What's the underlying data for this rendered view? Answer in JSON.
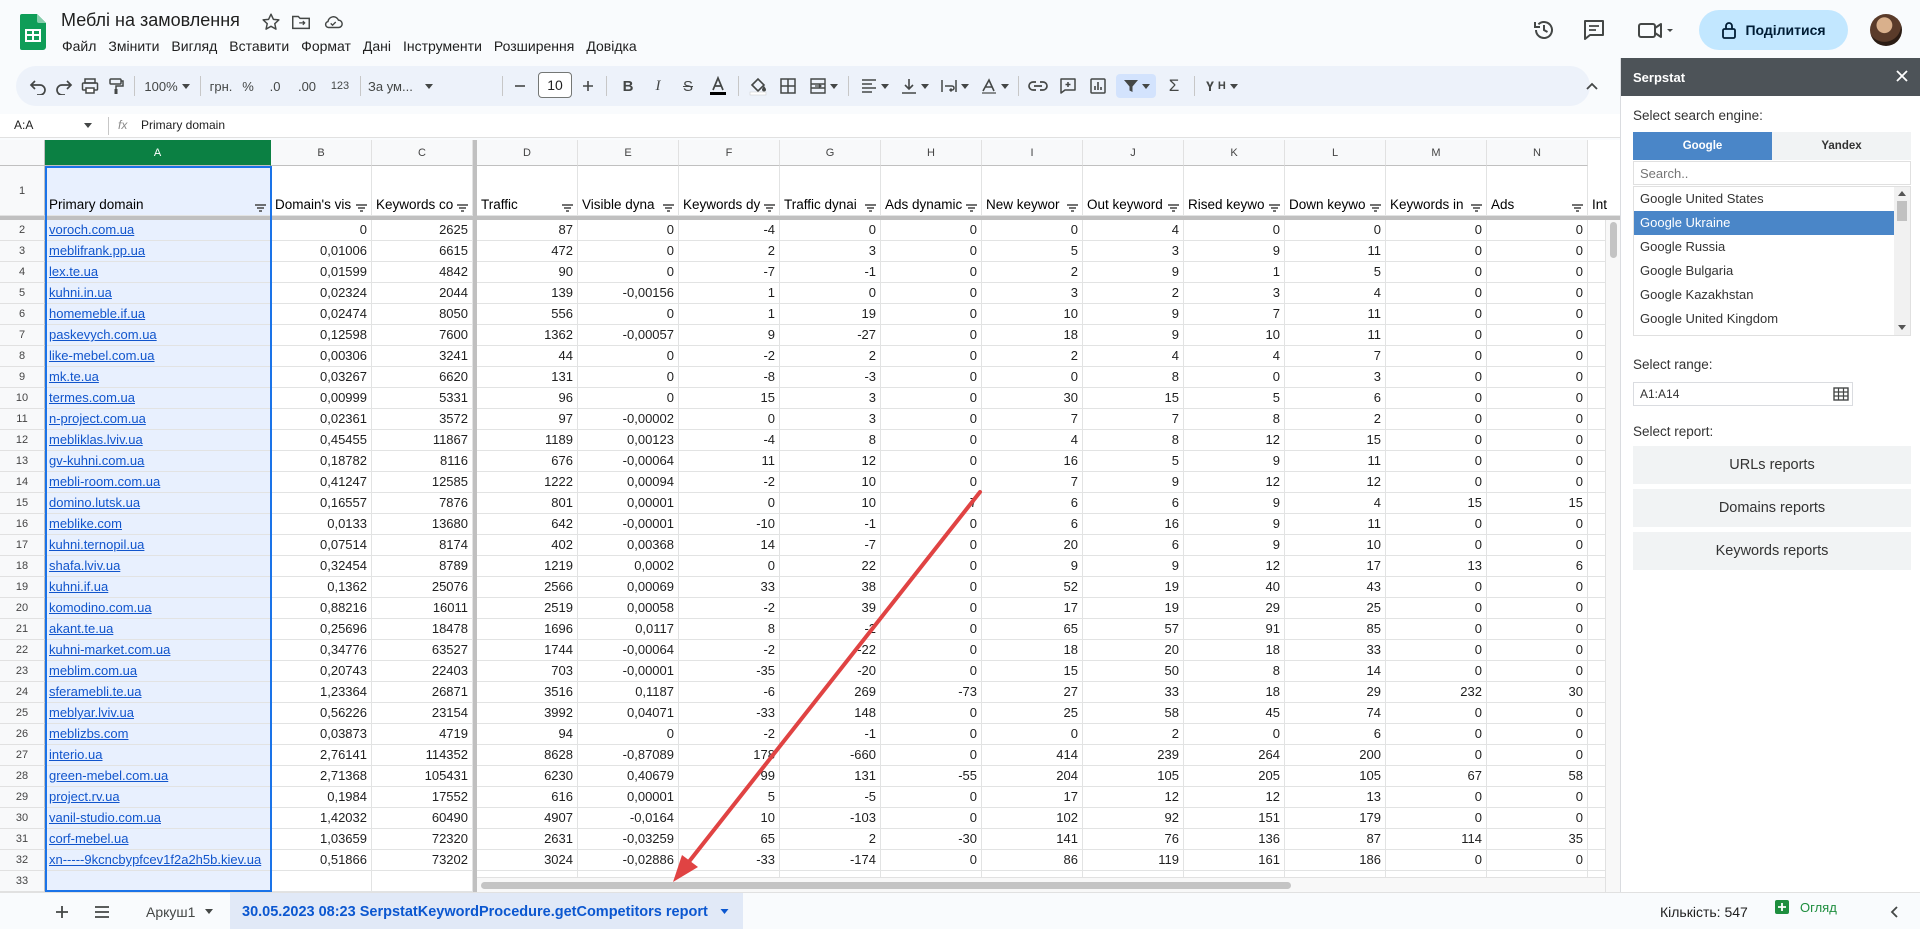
{
  "app": {
    "doc_title": "Меблі на замовлення"
  },
  "menu": [
    "Файл",
    "Змінити",
    "Вигляд",
    "Вставити",
    "Формат",
    "Дані",
    "Інструменти",
    "Розширення",
    "Довідка"
  ],
  "header": {
    "share_label": "Поділитися"
  },
  "toolbar": {
    "zoom": "100%",
    "currency": "грн.",
    "percent": "%",
    "dec_decrease": ".0",
    "dec_increase": ".00",
    "format_123": "123",
    "font": "За ум...",
    "font_size": "10"
  },
  "formula_bar": {
    "name_box": "A:A",
    "content": "Primary domain"
  },
  "columns": [
    "A",
    "B",
    "C",
    "D",
    "E",
    "F",
    "G",
    "H",
    "I",
    "J",
    "K",
    "L",
    "M",
    "N"
  ],
  "headers": [
    "Primary domain",
    "Domain's vis",
    "Keywords co",
    "Traffic",
    "Visible dyna",
    "Keywords dy",
    "Traffic dynai",
    "Ads dynamic",
    "New keywor",
    "Out keyword",
    "Rised keywo",
    "Down keywo",
    "Keywords in",
    "Ads",
    "Int"
  ],
  "rows": [
    [
      "voroch.com.ua",
      "0",
      "2625",
      "87",
      "0",
      "-4",
      "0",
      "0",
      "0",
      "4",
      "0",
      "0",
      "0",
      "0"
    ],
    [
      "meblifrank.pp.ua",
      "0,01006",
      "6615",
      "472",
      "0",
      "2",
      "3",
      "0",
      "5",
      "3",
      "9",
      "11",
      "0",
      "0"
    ],
    [
      "lex.te.ua",
      "0,01599",
      "4842",
      "90",
      "0",
      "-7",
      "-1",
      "0",
      "2",
      "9",
      "1",
      "5",
      "0",
      "0"
    ],
    [
      "kuhni.in.ua",
      "0,02324",
      "2044",
      "139",
      "-0,00156",
      "1",
      "0",
      "0",
      "3",
      "2",
      "3",
      "4",
      "0",
      "0"
    ],
    [
      "homemeble.if.ua",
      "0,02474",
      "8050",
      "556",
      "0",
      "1",
      "19",
      "0",
      "10",
      "9",
      "7",
      "11",
      "0",
      "0"
    ],
    [
      "paskevych.com.ua",
      "0,12598",
      "7600",
      "1362",
      "-0,00057",
      "9",
      "-27",
      "0",
      "18",
      "9",
      "10",
      "11",
      "0",
      "0"
    ],
    [
      "like-mebel.com.ua",
      "0,00306",
      "3241",
      "44",
      "0",
      "-2",
      "2",
      "0",
      "2",
      "4",
      "4",
      "7",
      "0",
      "0"
    ],
    [
      "mk.te.ua",
      "0,03267",
      "6620",
      "131",
      "0",
      "-8",
      "-3",
      "0",
      "0",
      "8",
      "0",
      "3",
      "0",
      "0"
    ],
    [
      "termes.com.ua",
      "0,00999",
      "5331",
      "96",
      "0",
      "15",
      "3",
      "0",
      "30",
      "15",
      "5",
      "6",
      "0",
      "0"
    ],
    [
      "n-project.com.ua",
      "0,02361",
      "3572",
      "97",
      "-0,00002",
      "0",
      "3",
      "0",
      "7",
      "7",
      "8",
      "2",
      "0",
      "0"
    ],
    [
      "mebliklas.lviv.ua",
      "0,45455",
      "11867",
      "1189",
      "0,00123",
      "-4",
      "8",
      "0",
      "4",
      "8",
      "12",
      "15",
      "0",
      "0"
    ],
    [
      "gv-kuhni.com.ua",
      "0,18782",
      "8116",
      "676",
      "-0,00064",
      "11",
      "12",
      "0",
      "16",
      "5",
      "9",
      "11",
      "0",
      "0"
    ],
    [
      "mebli-room.com.ua",
      "0,41247",
      "12585",
      "1222",
      "0,00094",
      "-2",
      "10",
      "0",
      "7",
      "9",
      "12",
      "12",
      "0",
      "0"
    ],
    [
      "domino.lutsk.ua",
      "0,16557",
      "7876",
      "801",
      "0,00001",
      "0",
      "10",
      "7",
      "6",
      "6",
      "9",
      "4",
      "15",
      "15"
    ],
    [
      "meblike.com",
      "0,0133",
      "13680",
      "642",
      "-0,00001",
      "-10",
      "-1",
      "0",
      "6",
      "16",
      "9",
      "11",
      "0",
      "0"
    ],
    [
      "kuhni.ternopil.ua",
      "0,07514",
      "8174",
      "402",
      "0,00368",
      "14",
      "-7",
      "0",
      "20",
      "6",
      "9",
      "10",
      "0",
      "0"
    ],
    [
      "shafa.lviv.ua",
      "0,32454",
      "8789",
      "1219",
      "0,0002",
      "0",
      "22",
      "0",
      "9",
      "9",
      "12",
      "17",
      "13",
      "6"
    ],
    [
      "kuhni.if.ua",
      "0,1362",
      "25076",
      "2566",
      "0,00069",
      "33",
      "38",
      "0",
      "52",
      "19",
      "40",
      "43",
      "0",
      "0"
    ],
    [
      "komodino.com.ua",
      "0,88216",
      "16011",
      "2519",
      "0,00058",
      "-2",
      "39",
      "0",
      "17",
      "19",
      "29",
      "25",
      "0",
      "0"
    ],
    [
      "akant.te.ua",
      "0,25696",
      "18478",
      "1696",
      "0,0117",
      "8",
      "-2",
      "0",
      "65",
      "57",
      "91",
      "85",
      "0",
      "0"
    ],
    [
      "kuhni-market.com.ua",
      "0,34776",
      "63527",
      "1744",
      "-0,00064",
      "-2",
      "-22",
      "0",
      "18",
      "20",
      "18",
      "33",
      "0",
      "0"
    ],
    [
      "meblim.com.ua",
      "0,20743",
      "22403",
      "703",
      "-0,00001",
      "-35",
      "-20",
      "0",
      "15",
      "50",
      "8",
      "14",
      "0",
      "0"
    ],
    [
      "sferamebli.te.ua",
      "1,23364",
      "26871",
      "3516",
      "0,1187",
      "-6",
      "269",
      "-73",
      "27",
      "33",
      "18",
      "29",
      "232",
      "30"
    ],
    [
      "meblyar.lviv.ua",
      "0,56226",
      "23154",
      "3992",
      "0,04071",
      "-33",
      "148",
      "0",
      "25",
      "58",
      "45",
      "74",
      "0",
      "0"
    ],
    [
      "meblizbs.com",
      "0,03873",
      "4719",
      "94",
      "0",
      "-2",
      "-1",
      "0",
      "0",
      "2",
      "0",
      "6",
      "0",
      "0"
    ],
    [
      "interio.ua",
      "2,76141",
      "114352",
      "8628",
      "-0,87089",
      "178",
      "-660",
      "0",
      "414",
      "239",
      "264",
      "200",
      "0",
      "0"
    ],
    [
      "green-mebel.com.ua",
      "2,71368",
      "105431",
      "6230",
      "0,40679",
      "99",
      "131",
      "-55",
      "204",
      "105",
      "205",
      "105",
      "67",
      "58"
    ],
    [
      "project.rv.ua",
      "0,1984",
      "17552",
      "616",
      "0,00001",
      "5",
      "-5",
      "0",
      "17",
      "12",
      "12",
      "13",
      "0",
      "0"
    ],
    [
      "vanil-studio.com.ua",
      "1,42032",
      "60490",
      "4907",
      "-0,0164",
      "10",
      "-103",
      "0",
      "102",
      "92",
      "151",
      "179",
      "0",
      "0"
    ],
    [
      "corf-mebel.ua",
      "1,03659",
      "72320",
      "2631",
      "-0,03259",
      "65",
      "2",
      "-30",
      "141",
      "76",
      "136",
      "87",
      "114",
      "35"
    ],
    [
      "xn-----9kcncbypfcev1f2a2h5b.kiev.ua",
      "0,51866",
      "73202",
      "3024",
      "-0,02886",
      "-33",
      "-174",
      "0",
      "86",
      "119",
      "161",
      "186",
      "0",
      "0"
    ]
  ],
  "bottom_bar": {
    "sheet1": "Аркуш1",
    "active_sheet": "30.05.2023 08:23 SerpstatKeywordProcedure.getCompetitors report",
    "count": "Кількість: 547",
    "explore": "Огляд"
  },
  "panel": {
    "title": "Serpstat",
    "engine_label": "Select search engine:",
    "engines": [
      "Google",
      "Yandex"
    ],
    "search_placeholder": "Search..",
    "countries": [
      "Google United States",
      "Google Ukraine",
      "Google Russia",
      "Google Bulgaria",
      "Google Kazakhstan",
      "Google United Kingdom"
    ],
    "selected_country": "Google Ukraine",
    "range_label": "Select range:",
    "range_value": "A1:A14",
    "report_label": "Select report:",
    "reports": [
      "URLs reports",
      "Domains reports",
      "Keywords reports"
    ]
  },
  "colors": {
    "accent": "#0b8043",
    "share": "#c2e7ff",
    "panel_header": "#4d5358",
    "engine_active": "#4a86c8",
    "arrow": "#e04343"
  }
}
